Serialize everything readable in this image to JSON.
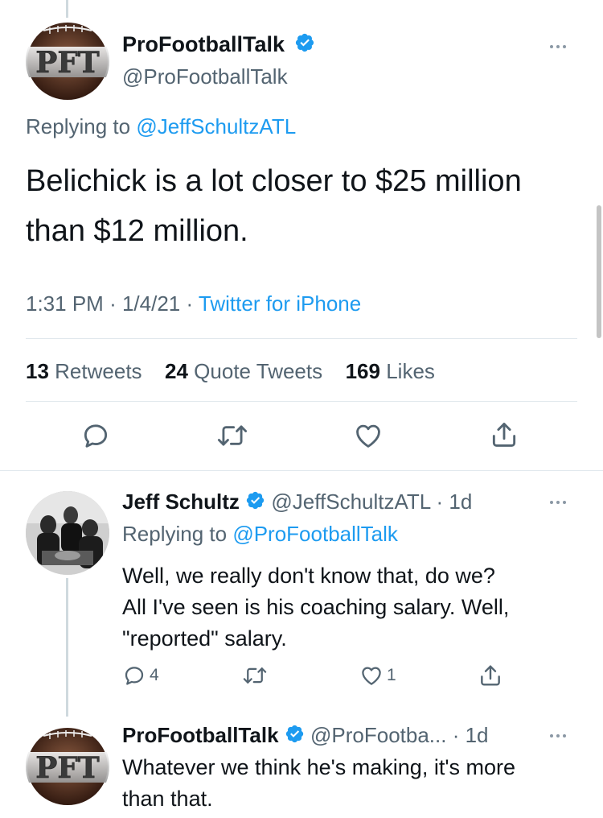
{
  "main_tweet": {
    "display_name": "ProFootballTalk",
    "handle": "@ProFootballTalk",
    "avatar_logo_text": "PFT",
    "replying_prefix": "Replying to",
    "replying_to": "@JeffSchultzATL",
    "text_line1": "Belichick is a lot closer to $25 million",
    "text_line2": "than $12 million.",
    "time": "1:31 PM",
    "date": "1/4/21",
    "source": "Twitter for iPhone",
    "stats": {
      "retweets_count": "13",
      "retweets_label": "Retweets",
      "quotes_count": "24",
      "quotes_label": "Quote Tweets",
      "likes_count": "169",
      "likes_label": "Likes"
    }
  },
  "reply1": {
    "display_name": "Jeff Schultz",
    "handle": "@JeffSchultzATL",
    "age": "1d",
    "replying_prefix": "Replying to",
    "replying_to": "@ProFootballTalk",
    "text_line1": "Well, we really don't know that, do we?",
    "text_line2": "All I've seen is his coaching salary. Well,",
    "text_line3": "\"reported\" salary.",
    "reply_count": "4",
    "like_count": "1"
  },
  "reply2": {
    "display_name": "ProFootballTalk",
    "handle": "@ProFootba...",
    "age": "1d",
    "avatar_logo_text": "PFT",
    "text_line1": "Whatever we think he's making, it's more",
    "text_line2": "than that."
  },
  "colors": {
    "accent": "#1d9bf0",
    "text": "#0f1419",
    "secondary": "#536471",
    "divider": "#e1e8ed"
  }
}
